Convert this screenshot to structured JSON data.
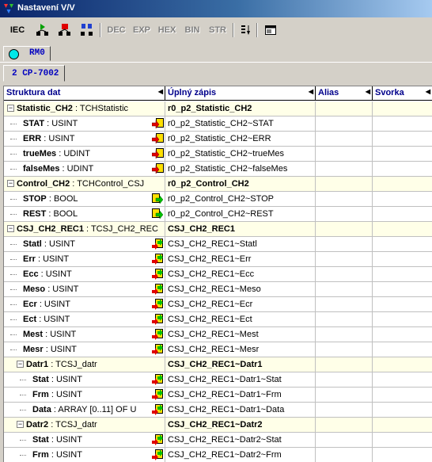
{
  "window": {
    "title": "Nastavení V/V"
  },
  "toolbar": {
    "iec": "IEC",
    "dec": "DEC",
    "exp": "EXP",
    "hex": "HEX",
    "bin": "BIN",
    "str": "STR"
  },
  "tabs": {
    "station": "RM0",
    "module": "2 CP-7002"
  },
  "columns": {
    "structure": "Struktura dat",
    "full": "Úplný zápis",
    "alias": "Alias",
    "terminal": "Svorka"
  },
  "rows": [
    {
      "name": "Statistic_CH2",
      "type": ": TCHStatistic",
      "full": "r0_p2_Statistic_CH2"
    },
    {
      "name": "STAT",
      "type": ": USINT",
      "full": "r0_p2_Statistic_CH2~STAT"
    },
    {
      "name": "ERR",
      "type": ": USINT",
      "full": "r0_p2_Statistic_CH2~ERR"
    },
    {
      "name": "trueMes",
      "type": ": UDINT",
      "full": "r0_p2_Statistic_CH2~trueMes"
    },
    {
      "name": "falseMes",
      "type": ": UDINT",
      "full": "r0_p2_Statistic_CH2~falseMes"
    },
    {
      "name": "Control_CH2",
      "type": ": TCHControl_CSJ",
      "full": "r0_p2_Control_CH2"
    },
    {
      "name": "STOP",
      "type": ": BOOL",
      "full": "r0_p2_Control_CH2~STOP"
    },
    {
      "name": "REST",
      "type": ": BOOL",
      "full": "r0_p2_Control_CH2~REST"
    },
    {
      "name": "CSJ_CH2_REC1",
      "type": ": TCSJ_CH2_REC",
      "full": "CSJ_CH2_REC1"
    },
    {
      "name": "Statl",
      "type": ": USINT",
      "full": "CSJ_CH2_REC1~Statl"
    },
    {
      "name": "Err",
      "type": ": USINT",
      "full": "CSJ_CH2_REC1~Err"
    },
    {
      "name": "Ecc",
      "type": ": USINT",
      "full": "CSJ_CH2_REC1~Ecc"
    },
    {
      "name": "Meso",
      "type": ": USINT",
      "full": "CSJ_CH2_REC1~Meso"
    },
    {
      "name": "Ecr",
      "type": ": USINT",
      "full": "CSJ_CH2_REC1~Ecr"
    },
    {
      "name": "Ect",
      "type": ": USINT",
      "full": "CSJ_CH2_REC1~Ect"
    },
    {
      "name": "Mest",
      "type": ": USINT",
      "full": "CSJ_CH2_REC1~Mest"
    },
    {
      "name": "Mesr",
      "type": ": USINT",
      "full": "CSJ_CH2_REC1~Mesr"
    },
    {
      "name": "Datr1",
      "type": ": TCSJ_datr",
      "full": "CSJ_CH2_REC1~Datr1"
    },
    {
      "name": "Stat",
      "type": ": USINT",
      "full": "CSJ_CH2_REC1~Datr1~Stat"
    },
    {
      "name": "Frm",
      "type": ": USINT",
      "full": "CSJ_CH2_REC1~Datr1~Frm"
    },
    {
      "name": "Data",
      "type": ": ARRAY [0..11] OF U",
      "full": "CSJ_CH2_REC1~Datr1~Data"
    },
    {
      "name": "Datr2",
      "type": ": TCSJ_datr",
      "full": "CSJ_CH2_REC1~Datr2"
    },
    {
      "name": "Stat",
      "type": ": USINT",
      "full": "CSJ_CH2_REC1~Datr2~Stat"
    },
    {
      "name": "Frm",
      "type": ": USINT",
      "full": "CSJ_CH2_REC1~Datr2~Frm"
    }
  ]
}
